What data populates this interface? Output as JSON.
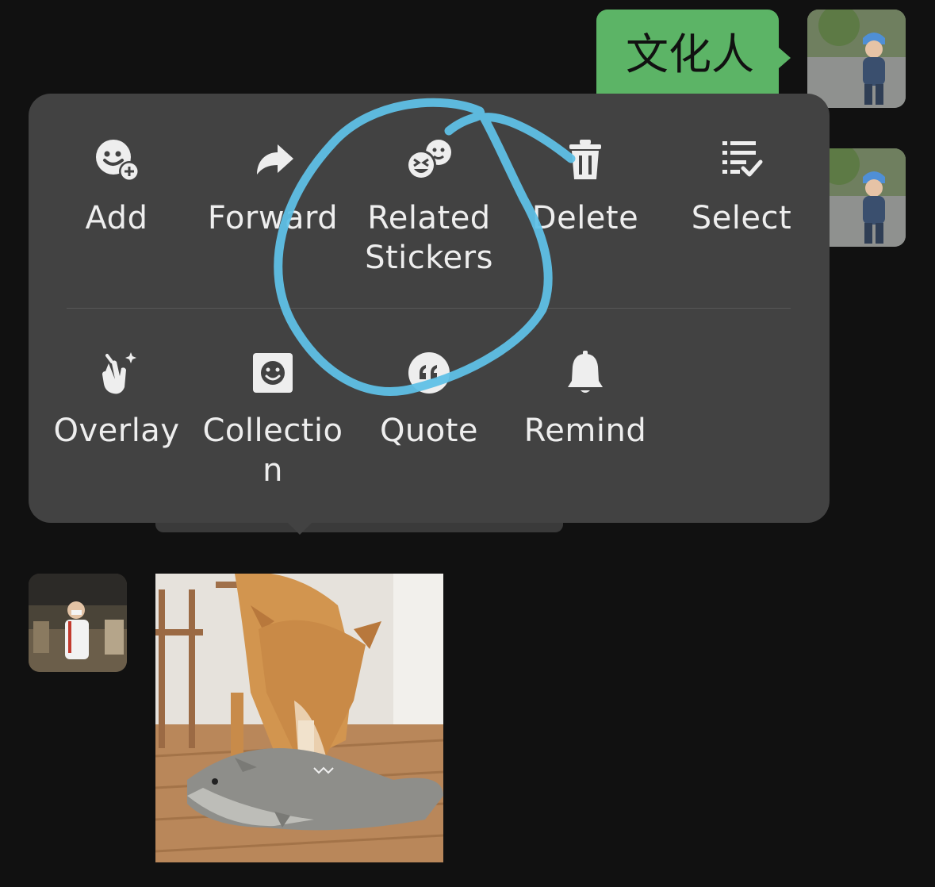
{
  "chat": {
    "outgoing_text": "文化人"
  },
  "menu": {
    "row1": [
      {
        "label": "Add",
        "icon": "emoji-add-icon"
      },
      {
        "label": "Forward",
        "icon": "forward-arrow-icon"
      },
      {
        "label": "Related\nStickers",
        "icon": "related-stickers-icon"
      },
      {
        "label": "Delete",
        "icon": "trash-icon"
      },
      {
        "label": "Select",
        "icon": "select-list-icon"
      }
    ],
    "row2": [
      {
        "label": "Overlay",
        "icon": "overlay-hand-icon"
      },
      {
        "label": "Collectio\nn",
        "icon": "collection-icon"
      },
      {
        "label": "Quote",
        "icon": "quote-icon"
      },
      {
        "label": "Remind",
        "icon": "bell-icon"
      }
    ]
  },
  "colors": {
    "background": "#111111",
    "menu": "#424242",
    "bubble": "#5cb466",
    "annotation": "#5fc0e6"
  }
}
